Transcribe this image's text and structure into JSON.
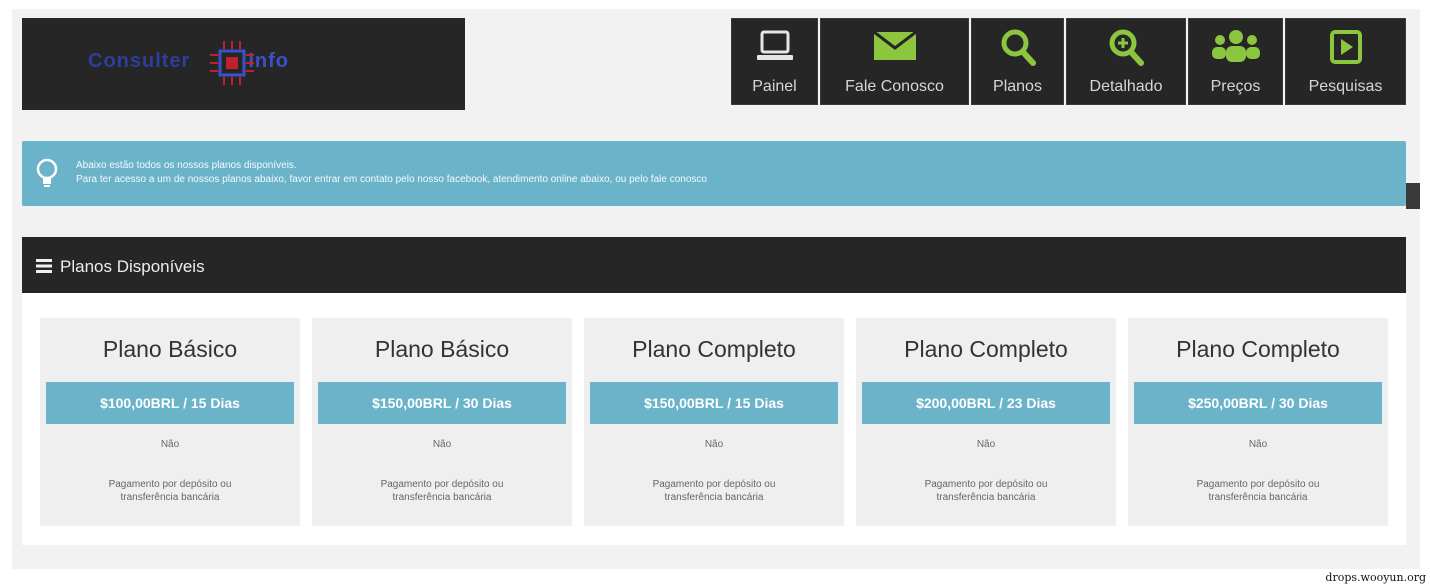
{
  "header": {
    "logo": {
      "left": "Consulter",
      "right": "Info"
    },
    "nav": [
      {
        "label": "Painel",
        "icon": "laptop-icon"
      },
      {
        "label": "Fale Conosco",
        "icon": "envelope-icon"
      },
      {
        "label": "Planos",
        "icon": "search-icon"
      },
      {
        "label": "Detalhado",
        "icon": "zoom-in-icon"
      },
      {
        "label": "Preços",
        "icon": "users-icon"
      },
      {
        "label": "Pesquisas",
        "icon": "play-icon"
      }
    ]
  },
  "info": {
    "icon": "lightbulb-icon",
    "line1": "Abaixo estão todos os nossos planos disponíveis.",
    "line2": "Para ter acesso a um de nossos planos abaixo, favor entrar em contato pelo nosso facebook, atendimento online abaixo, ou pelo fale conosco"
  },
  "panel": {
    "icon": "menu-icon",
    "title": "Planos Disponíveis"
  },
  "plans": [
    {
      "name": "Plano Básico",
      "price": "$100,00BRL / 15 Dias",
      "flag": "Não",
      "payment": "Pagamento por depósito ou transferência bancária"
    },
    {
      "name": "Plano Básico",
      "price": "$150,00BRL / 30 Dias",
      "flag": "Não",
      "payment": "Pagamento por depósito ou transferência bancária"
    },
    {
      "name": "Plano Completo",
      "price": "$150,00BRL / 15 Dias",
      "flag": "Não",
      "payment": "Pagamento por depósito ou transferência bancária"
    },
    {
      "name": "Plano Completo",
      "price": "$200,00BRL / 23 Dias",
      "flag": "Não",
      "payment": "Pagamento por depósito ou transferência bancária"
    },
    {
      "name": "Plano Completo",
      "price": "$250,00BRL / 30 Dias",
      "flag": "Não",
      "payment": "Pagamento por depósito ou transferência bancária"
    }
  ],
  "footer": {
    "credit": "drops.wooyun.org"
  },
  "colors": {
    "accent": "#6ab3c8",
    "dark": "#262626",
    "nav_icon": "#8cc63f"
  }
}
